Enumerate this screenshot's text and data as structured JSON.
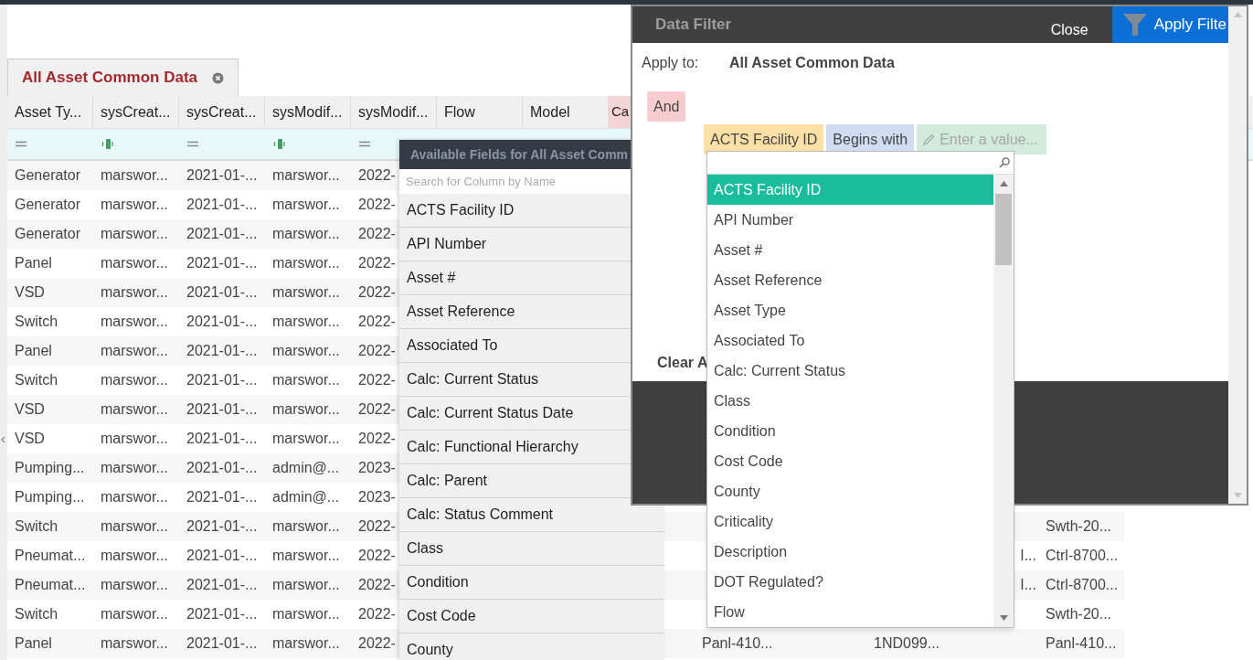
{
  "tab": {
    "label": "All Asset Common Data",
    "selected": true
  },
  "grid": {
    "columns": [
      {
        "label": "Asset Ty...",
        "selected": false
      },
      {
        "label": "sysCreat...",
        "selected": false
      },
      {
        "label": "sysCreat...",
        "selected": false
      },
      {
        "label": "sysModif...",
        "selected": false
      },
      {
        "label": "sysModif...",
        "selected": false
      },
      {
        "label": "Flow",
        "selected": false
      },
      {
        "label": "Model",
        "selected": false
      },
      {
        "label": "Ca",
        "selected": true
      }
    ],
    "filter_row": [
      {
        "kind": "equals"
      },
      {
        "kind": "text"
      },
      {
        "kind": "equals"
      },
      {
        "kind": "text"
      },
      {
        "kind": "equals"
      }
    ],
    "rows": [
      {
        "cells": [
          "Generator",
          "marswor...",
          "2021-01-...",
          "marswor...",
          "2022-"
        ]
      },
      {
        "cells": [
          "Generator",
          "marswor...",
          "2021-01-...",
          "marswor...",
          "2022-"
        ]
      },
      {
        "cells": [
          "Generator",
          "marswor...",
          "2021-01-...",
          "marswor...",
          "2022-"
        ]
      },
      {
        "cells": [
          "Panel",
          "marswor...",
          "2021-01-...",
          "marswor...",
          "2022-"
        ]
      },
      {
        "cells": [
          "VSD",
          "marswor...",
          "2021-01-...",
          "marswor...",
          "2022-"
        ]
      },
      {
        "cells": [
          "Switch",
          "marswor...",
          "2021-01-...",
          "marswor...",
          "2022-"
        ]
      },
      {
        "cells": [
          "Panel",
          "marswor...",
          "2021-01-...",
          "marswor...",
          "2022-"
        ]
      },
      {
        "cells": [
          "Switch",
          "marswor...",
          "2021-01-...",
          "marswor...",
          "2022-"
        ]
      },
      {
        "cells": [
          "VSD",
          "marswor...",
          "2021-01-...",
          "marswor...",
          "2022-"
        ]
      },
      {
        "cells": [
          "VSD",
          "marswor...",
          "2021-01-...",
          "marswor...",
          "2022-"
        ]
      },
      {
        "cells": [
          "Pumping...",
          "marswor...",
          "2021-01-...",
          "admin@...",
          "2023-"
        ]
      },
      {
        "cells": [
          "Pumping...",
          "marswor...",
          "2021-01-...",
          "admin@...",
          "2023-"
        ]
      },
      {
        "cells": [
          "Switch",
          "marswor...",
          "2021-01-...",
          "marswor...",
          "2022-"
        ],
        "column_13": "Swth-20..."
      },
      {
        "cells": [
          "Pneumat...",
          "marswor...",
          "2021-01-...",
          "marswor...",
          "2022-"
        ],
        "column_12": "I...",
        "column_13": "Ctrl-8700..."
      },
      {
        "cells": [
          "Pneumat...",
          "marswor...",
          "2021-01-...",
          "marswor...",
          "2022-"
        ],
        "column_12": "I...",
        "column_13": "Ctrl-8700..."
      },
      {
        "cells": [
          "Switch",
          "marswor...",
          "2021-01-...",
          "marswor...",
          "2022-"
        ],
        "column_13": "Swth-20..."
      },
      {
        "cells": [
          "Panel",
          "marswor...",
          "2021-01-...",
          "marswor...",
          "2022-"
        ],
        "column_9": "Panl-410...",
        "column_11": "1ND099...",
        "column_13": "Panl-410..."
      }
    ]
  },
  "available_fields": {
    "title": "Available Fields for All Asset Comm",
    "search_placeholder": "Search for Column by Name",
    "items": [
      "ACTS Facility ID",
      "API Number",
      "Asset #",
      "Asset Reference",
      "Associated To",
      "Calc: Current Status",
      "Calc: Current Status Date",
      "Calc: Functional Hierarchy",
      "Calc: Parent",
      "Calc: Status Comment",
      "Class",
      "Condition",
      "Cost Code",
      "County"
    ]
  },
  "data_filter": {
    "title": "Data Filter",
    "close": "Close",
    "apply": "Apply Filte",
    "apply_to_label": "Apply to:",
    "apply_to_value": "All Asset Common Data",
    "group_operator": "And",
    "condition": {
      "field": "ACTS Facility ID",
      "operator": "Begins with",
      "value_placeholder": "Enter a value..."
    },
    "clear": "Clear A"
  },
  "field_dropdown": {
    "items": [
      {
        "label": "ACTS Facility ID",
        "selected": true
      },
      {
        "label": "API Number",
        "selected": false
      },
      {
        "label": "Asset #",
        "selected": false
      },
      {
        "label": "Asset Reference",
        "selected": false
      },
      {
        "label": "Asset Type",
        "selected": false
      },
      {
        "label": "Associated To",
        "selected": false
      },
      {
        "label": "Calc: Current Status",
        "selected": false
      },
      {
        "label": "Class",
        "selected": false
      },
      {
        "label": "Condition",
        "selected": false
      },
      {
        "label": "Cost Code",
        "selected": false
      },
      {
        "label": "County",
        "selected": false
      },
      {
        "label": "Criticality",
        "selected": false
      },
      {
        "label": "Description",
        "selected": false
      },
      {
        "label": "DOT Regulated?",
        "selected": false
      },
      {
        "label": "Flow",
        "selected": false
      }
    ]
  }
}
